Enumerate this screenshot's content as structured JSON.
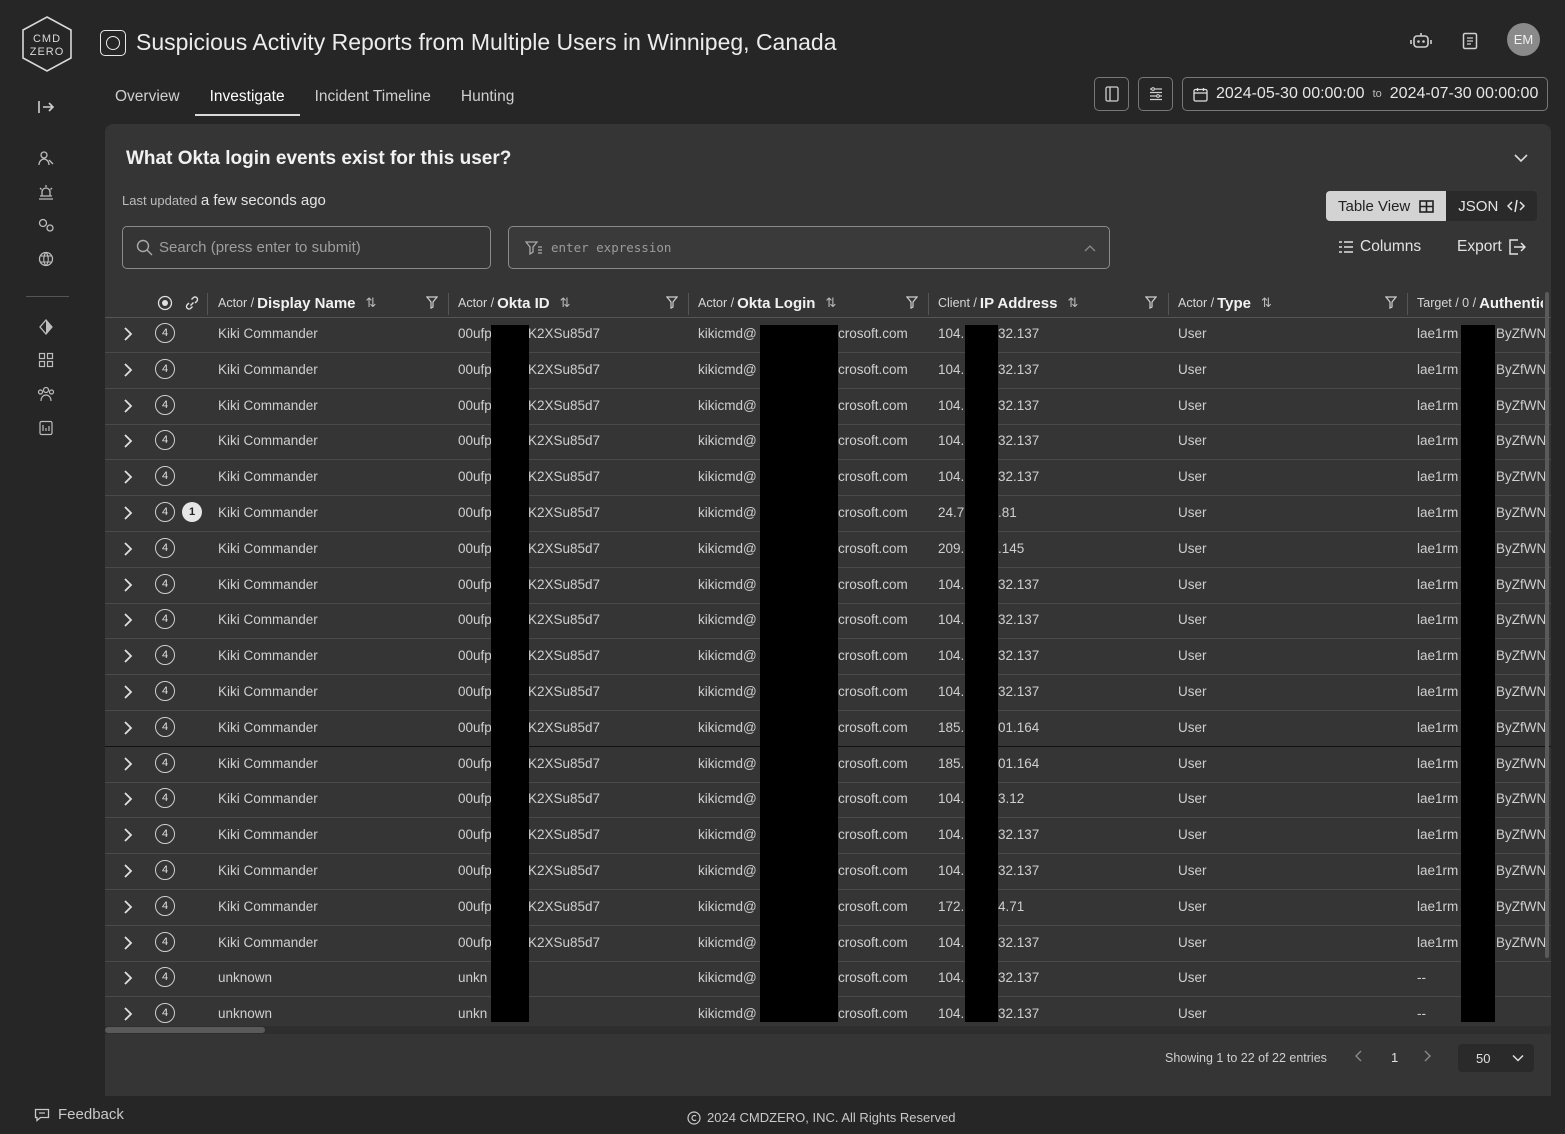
{
  "header": {
    "title": "Suspicious Activity Reports from Multiple Users in Winnipeg, Canada",
    "avatar_initials": "EM",
    "tabs": [
      {
        "label": "Overview"
      },
      {
        "label": "Investigate"
      },
      {
        "label": "Incident Timeline"
      },
      {
        "label": "Hunting"
      }
    ],
    "active_tab": "Investigate",
    "date_from": "2024-05-30 00:00:00",
    "date_to_label": "to",
    "date_to": "2024-07-30 00:00:00"
  },
  "sidebar": {
    "logo_text": "CMD ZERO",
    "feedback_label": "Feedback"
  },
  "panel": {
    "question": "What Okta login events exist for this user?",
    "last_updated_label": "Last updated",
    "last_updated_value": "a few seconds ago",
    "table_view_label": "Table View",
    "json_label": "JSON",
    "search_placeholder": "Search (press enter to submit)",
    "expression_placeholder": "enter expression",
    "columns_label": "Columns",
    "export_label": "Export"
  },
  "table": {
    "columns": [
      {
        "prefix": "Actor /",
        "name": "Display Name"
      },
      {
        "prefix": "Actor /",
        "name": "Okta ID"
      },
      {
        "prefix": "Actor /",
        "name": "Okta Login"
      },
      {
        "prefix": "Client /",
        "name": "IP Address"
      },
      {
        "prefix": "Actor /",
        "name": "Type"
      },
      {
        "prefix": "Target / 0 /",
        "name": "Authentic"
      }
    ],
    "rows": [
      {
        "count": "4",
        "name": "Kiki Commander",
        "id_a": "00ufp",
        "id_b": "K2XSu85d7",
        "login_a": "kikicmd@",
        "login_b": "crosoft.com",
        "ip_a": "104.",
        "ip_b": "32.137",
        "type": "User",
        "target_a": "lae1rm",
        "target_b": "ByZfWN"
      },
      {
        "count": "4",
        "name": "Kiki Commander",
        "id_a": "00ufp",
        "id_b": "K2XSu85d7",
        "login_a": "kikicmd@",
        "login_b": "crosoft.com",
        "ip_a": "104.",
        "ip_b": "32.137",
        "type": "User",
        "target_a": "lae1rm",
        "target_b": "ByZfWN"
      },
      {
        "count": "4",
        "name": "Kiki Commander",
        "id_a": "00ufp",
        "id_b": "K2XSu85d7",
        "login_a": "kikicmd@",
        "login_b": "crosoft.com",
        "ip_a": "104.",
        "ip_b": "32.137",
        "type": "User",
        "target_a": "lae1rm",
        "target_b": "ByZfWN"
      },
      {
        "count": "4",
        "name": "Kiki Commander",
        "id_a": "00ufp",
        "id_b": "K2XSu85d7",
        "login_a": "kikicmd@",
        "login_b": "crosoft.com",
        "ip_a": "104.",
        "ip_b": "32.137",
        "type": "User",
        "target_a": "lae1rm",
        "target_b": "ByZfWN"
      },
      {
        "count": "4",
        "name": "Kiki Commander",
        "id_a": "00ufp",
        "id_b": "K2XSu85d7",
        "login_a": "kikicmd@",
        "login_b": "crosoft.com",
        "ip_a": "104.",
        "ip_b": "32.137",
        "type": "User",
        "target_a": "lae1rm",
        "target_b": "ByZfWN"
      },
      {
        "count": "4",
        "badge": "1",
        "name": "Kiki Commander",
        "id_a": "00ufp",
        "id_b": "K2XSu85d7",
        "login_a": "kikicmd@",
        "login_b": "crosoft.com",
        "ip_a": "24.7",
        "ip_b": ".81",
        "type": "User",
        "target_a": "lae1rm",
        "target_b": "ByZfWN"
      },
      {
        "count": "4",
        "name": "Kiki Commander",
        "id_a": "00ufp",
        "id_b": "K2XSu85d7",
        "login_a": "kikicmd@",
        "login_b": "crosoft.com",
        "ip_a": "209.",
        "ip_b": ".145",
        "type": "User",
        "target_a": "lae1rm",
        "target_b": "ByZfWN"
      },
      {
        "count": "4",
        "name": "Kiki Commander",
        "id_a": "00ufp",
        "id_b": "K2XSu85d7",
        "login_a": "kikicmd@",
        "login_b": "crosoft.com",
        "ip_a": "104.",
        "ip_b": "32.137",
        "type": "User",
        "target_a": "lae1rm",
        "target_b": "ByZfWN"
      },
      {
        "count": "4",
        "name": "Kiki Commander",
        "id_a": "00ufp",
        "id_b": "K2XSu85d7",
        "login_a": "kikicmd@",
        "login_b": "crosoft.com",
        "ip_a": "104.",
        "ip_b": "32.137",
        "type": "User",
        "target_a": "lae1rm",
        "target_b": "ByZfWN"
      },
      {
        "count": "4",
        "name": "Kiki Commander",
        "id_a": "00ufp",
        "id_b": "K2XSu85d7",
        "login_a": "kikicmd@",
        "login_b": "crosoft.com",
        "ip_a": "104.",
        "ip_b": "32.137",
        "type": "User",
        "target_a": "lae1rm",
        "target_b": "ByZfWN"
      },
      {
        "count": "4",
        "name": "Kiki Commander",
        "id_a": "00ufp",
        "id_b": "K2XSu85d7",
        "login_a": "kikicmd@",
        "login_b": "crosoft.com",
        "ip_a": "104.",
        "ip_b": "32.137",
        "type": "User",
        "target_a": "lae1rm",
        "target_b": "ByZfWN"
      },
      {
        "count": "4",
        "name": "Kiki Commander",
        "id_a": "00ufp",
        "id_b": "K2XSu85d7",
        "login_a": "kikicmd@",
        "login_b": "crosoft.com",
        "ip_a": "185.",
        "ip_b": "01.164",
        "type": "User",
        "target_a": "lae1rm",
        "target_b": "ByZfWN"
      },
      {
        "count": "4",
        "name": "Kiki Commander",
        "id_a": "00ufp",
        "id_b": "K2XSu85d7",
        "login_a": "kikicmd@",
        "login_b": "crosoft.com",
        "ip_a": "185.",
        "ip_b": "01.164",
        "type": "User",
        "target_a": "lae1rm",
        "target_b": "ByZfWN"
      },
      {
        "count": "4",
        "name": "Kiki Commander",
        "id_a": "00ufp",
        "id_b": "K2XSu85d7",
        "login_a": "kikicmd@",
        "login_b": "crosoft.com",
        "ip_a": "104.",
        "ip_b": "3.12",
        "type": "User",
        "target_a": "lae1rm",
        "target_b": "ByZfWN"
      },
      {
        "count": "4",
        "name": "Kiki Commander",
        "id_a": "00ufp",
        "id_b": "K2XSu85d7",
        "login_a": "kikicmd@",
        "login_b": "crosoft.com",
        "ip_a": "104.",
        "ip_b": "32.137",
        "type": "User",
        "target_a": "lae1rm",
        "target_b": "ByZfWN"
      },
      {
        "count": "4",
        "name": "Kiki Commander",
        "id_a": "00ufp",
        "id_b": "K2XSu85d7",
        "login_a": "kikicmd@",
        "login_b": "crosoft.com",
        "ip_a": "104.",
        "ip_b": "32.137",
        "type": "User",
        "target_a": "lae1rm",
        "target_b": "ByZfWN"
      },
      {
        "count": "4",
        "name": "Kiki Commander",
        "id_a": "00ufp",
        "id_b": "K2XSu85d7",
        "login_a": "kikicmd@",
        "login_b": "crosoft.com",
        "ip_a": "172.",
        "ip_b": "4.71",
        "type": "User",
        "target_a": "lae1rm",
        "target_b": "ByZfWN"
      },
      {
        "count": "4",
        "name": "Kiki Commander",
        "id_a": "00ufp",
        "id_b": "K2XSu85d7",
        "login_a": "kikicmd@",
        "login_b": "crosoft.com",
        "ip_a": "104.",
        "ip_b": "32.137",
        "type": "User",
        "target_a": "lae1rm",
        "target_b": "ByZfWN"
      },
      {
        "count": "4",
        "name": "unknown",
        "id_a": "unkn",
        "id_b": "",
        "login_a": "kikicmd@",
        "login_b": "crosoft.com",
        "ip_a": "104.",
        "ip_b": "32.137",
        "type": "User",
        "target_a": "--",
        "target_b": ""
      },
      {
        "count": "4",
        "name": "unknown",
        "id_a": "unkn",
        "id_b": "",
        "login_a": "kikicmd@",
        "login_b": "crosoft.com",
        "ip_a": "104.",
        "ip_b": "32.137",
        "type": "User",
        "target_a": "--",
        "target_b": ""
      }
    ]
  },
  "pagination": {
    "showing_text": "Showing 1 to 22 of 22 entries",
    "current_page": "1",
    "page_size": "50"
  },
  "footer": {
    "copyright": "2024 CMDZERO, INC.  All Rights Reserved"
  }
}
